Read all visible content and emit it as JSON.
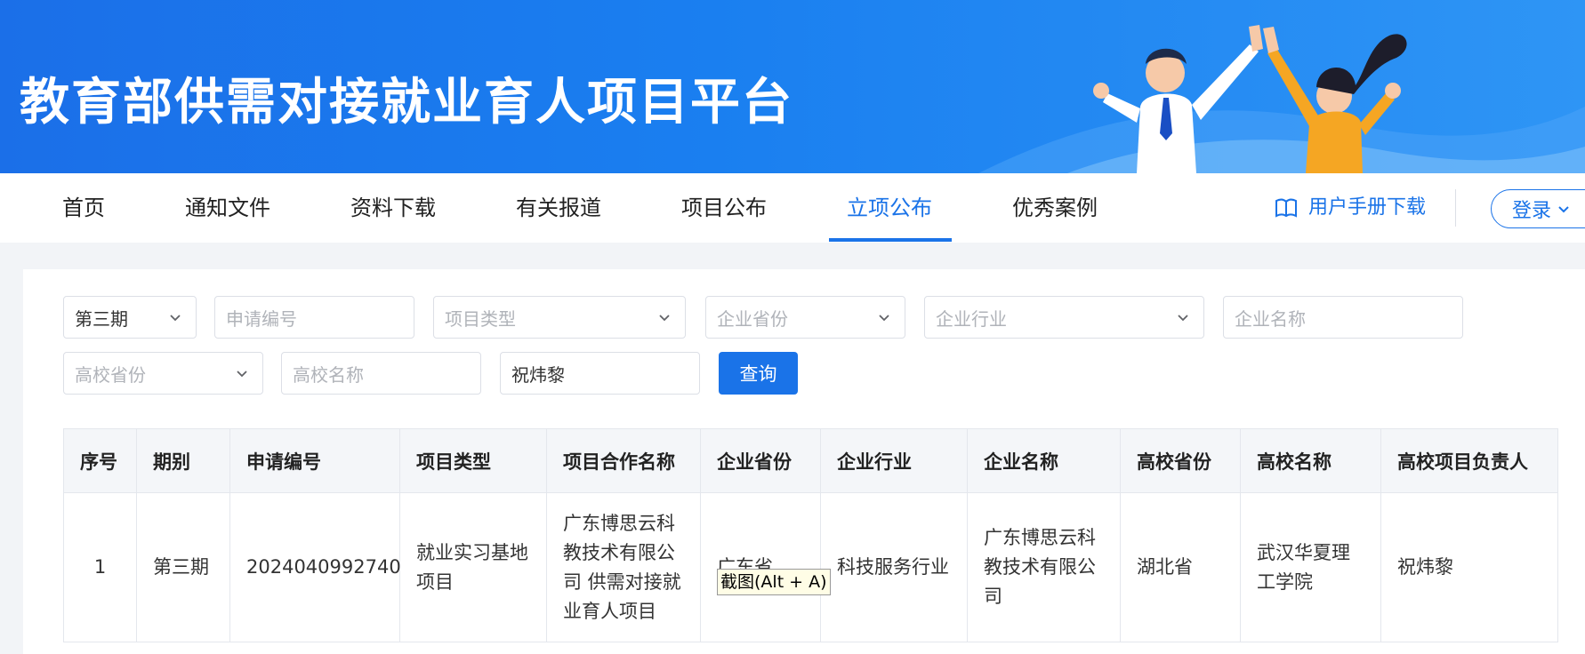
{
  "banner": {
    "title": "教育部供需对接就业育人项目平台"
  },
  "nav": {
    "items": [
      "首页",
      "通知文件",
      "资料下载",
      "有关报道",
      "项目公布",
      "立项公布",
      "优秀案例"
    ],
    "manual": "用户手册下载",
    "login": "登录"
  },
  "filters": {
    "period": "第三期",
    "app_no": "申请编号",
    "project_type": "项目类型",
    "company_province": "企业省份",
    "company_industry": "企业行业",
    "company_name": "企业名称",
    "school_province": "高校省份",
    "school_name": "高校名称",
    "leader": "祝炜黎",
    "query": "查询"
  },
  "table": {
    "headers": [
      "序号",
      "期别",
      "申请编号",
      "项目类型",
      "项目合作名称",
      "企业省份",
      "企业行业",
      "企业名称",
      "高校省份",
      "高校名称",
      "高校项目负责人"
    ],
    "rows": [
      [
        "1",
        "第三期",
        "2024040992740",
        "就业实习基地项目",
        "广东博思云科教技术有限公司 供需对接就业育人项目",
        "广东省",
        "科技服务行业",
        "广东博思云科教技术有限公司",
        "湖北省",
        "武汉华夏理工学院",
        "祝炜黎"
      ]
    ]
  },
  "tooltip": "截图(Alt + A)",
  "colors": {
    "primary": "#1a73e8",
    "banner": "#1b6fe8"
  }
}
